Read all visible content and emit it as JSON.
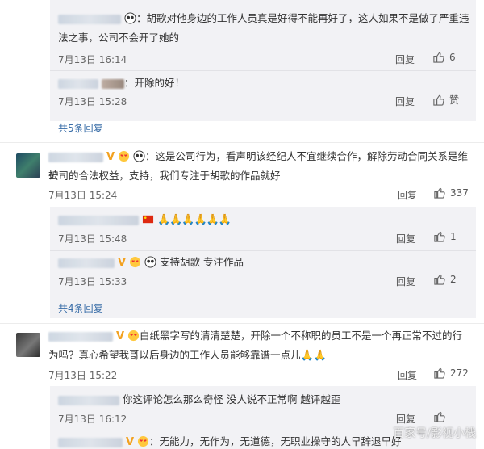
{
  "thread": {
    "r1": {
      "text": "：胡歌对他身边的工作人员真是好得不能再好了，这人如果不是做了严重违",
      "text2": "法之事，公司不会开了她的",
      "time": "7月13日 16:14",
      "reply": "回复",
      "likes": "6"
    },
    "r2": {
      "text": "：开除的好！",
      "time": "7月13日 15:28",
      "reply": "回复",
      "likes": "赞"
    },
    "more1": "共5条回复",
    "c1": {
      "text": "：这是公司行为，看声明该经纪人不宜继续合作，解除劳动合同关系是维护",
      "text2": "公司的合法权益，支持，我们专注于胡歌的作品就好",
      "time": "7月13日 15:24",
      "reply": "回复",
      "likes": "337"
    },
    "c1r1": {
      "time": "7月13日 15:48",
      "reply": "回复",
      "likes": "1"
    },
    "c1r2": {
      "text": "支持胡歌 专注作品",
      "time": "7月13日 15:33",
      "reply": "回复",
      "likes": "2"
    },
    "more2": "共4条回复",
    "c2": {
      "text": "白纸黑字写的清清楚楚，开除一个不称职的员工不是一个再正常不过的行",
      "text2": "为吗？真心希望我哥以后身边的工作人员能够靠谱一点儿",
      "time": "7月13日 15:22",
      "reply": "回复",
      "likes": "272"
    },
    "c2r1": {
      "text": "你这评论怎么那么奇怪 没人说不正常啊 越评越歪",
      "time": "7月13日 16:12",
      "reply": "回复"
    },
    "c2r2": {
      "text": "：无能力，无作为，无道德，无职业操守的人早辞退早好"
    },
    "watermark": "百家号/影视小栈"
  },
  "colors": {
    "link": "#3a6ea8",
    "badge": "#f2a11f",
    "reply_bg": "#f2f2f5"
  }
}
